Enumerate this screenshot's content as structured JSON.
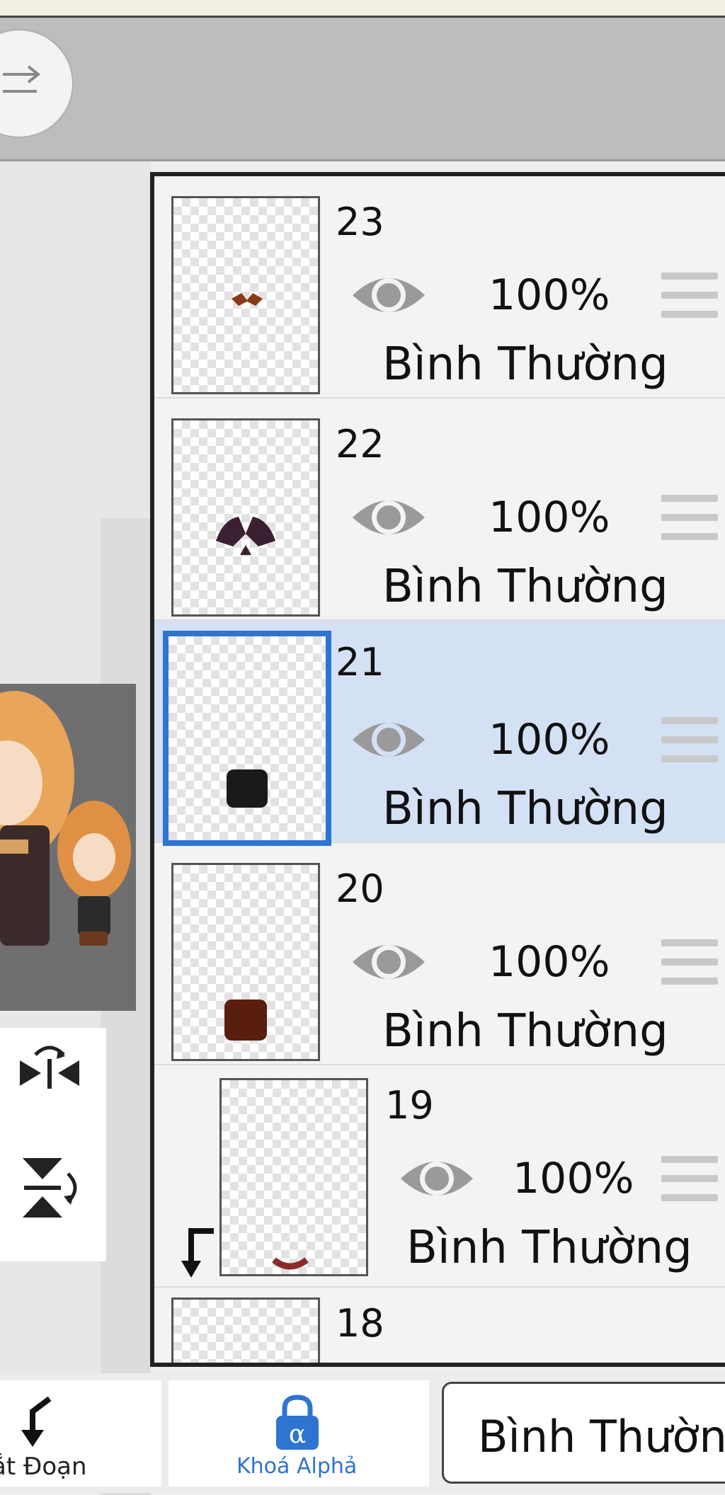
{
  "toolbar": {
    "redo_icon": "redo-arrow-icon"
  },
  "layers": [
    {
      "number": "23",
      "opacity": "100%",
      "blend": "Bình Thường",
      "selected": false,
      "clipped": false
    },
    {
      "number": "22",
      "opacity": "100%",
      "blend": "Bình Thường",
      "selected": false,
      "clipped": false
    },
    {
      "number": "21",
      "opacity": "100%",
      "blend": "Bình Thường",
      "selected": true,
      "clipped": false
    },
    {
      "number": "20",
      "opacity": "100%",
      "blend": "Bình Thường",
      "selected": false,
      "clipped": false
    },
    {
      "number": "19",
      "opacity": "100%",
      "blend": "Bình Thường",
      "selected": false,
      "clipped": true
    },
    {
      "number": "18"
    }
  ],
  "bottom": {
    "clip_label": "ắt Đoạn",
    "alpha_label": "Khoá Alphả",
    "blend_mode": "Bình Thườn"
  },
  "colors": {
    "selected_bg": "#d4e1f5",
    "accent": "#2f74d0"
  }
}
